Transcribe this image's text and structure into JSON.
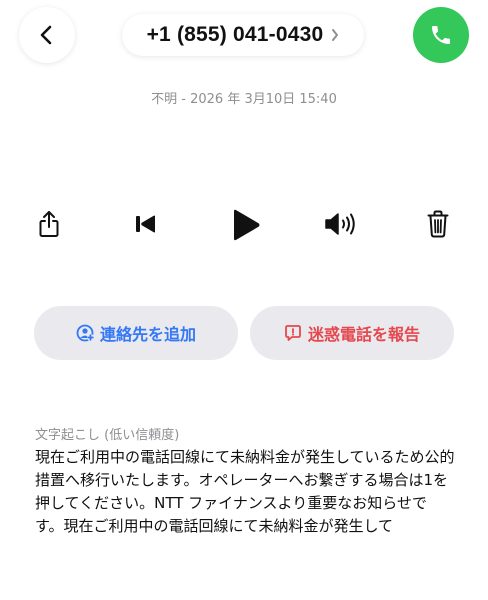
{
  "header": {
    "back_icon": "chevron-left-icon",
    "phone_number": "+1 (855) 041-0430",
    "detail_chevron_icon": "chevron-right-icon",
    "call_icon": "phone-icon",
    "call_color": "#34c759"
  },
  "meta": {
    "line": "不明 - 2026 年 3月10日 15:40"
  },
  "controls": {
    "share_icon": "share-icon",
    "skip_back_icon": "skip-back-icon",
    "play_icon": "play-icon",
    "speaker_icon": "speaker-icon",
    "trash_icon": "trash-icon"
  },
  "actions": {
    "add_contact_label": "連絡先を追加",
    "add_contact_icon": "person-add-icon",
    "add_contact_color": "#3478f6",
    "report_label": "迷惑電話を報告",
    "report_icon": "report-icon",
    "report_color": "#e5484d"
  },
  "transcript": {
    "label": "文字起こし (低い信頼度)",
    "text": "現在ご利用中の電話回線にて未納料金が発生しているため公的措置へ移行いたします。オペレーターへお繋ぎする場合は1を押してください。NTT ファイナンスより重要なお知らせです。現在ご利用中の電話回線にて未納料金が発生して"
  }
}
